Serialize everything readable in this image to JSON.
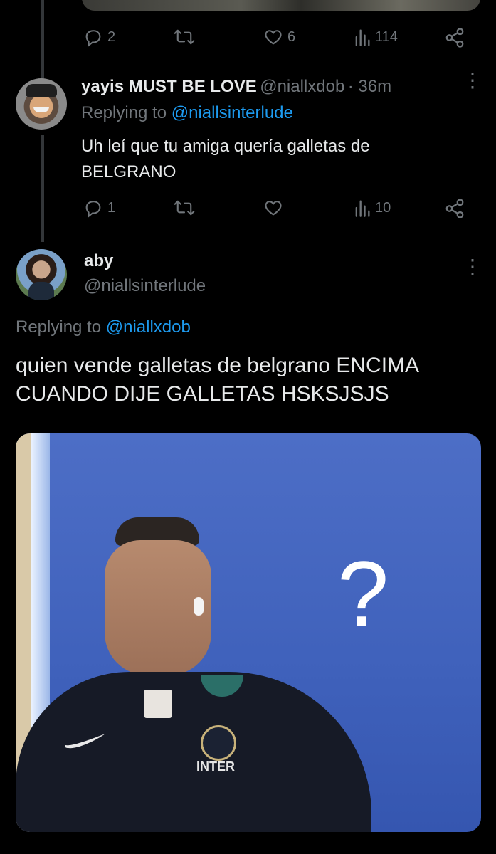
{
  "top_tweet": {
    "actions": {
      "replies": "2",
      "retweets": "",
      "likes": "6",
      "views": "114"
    }
  },
  "reply_tweet": {
    "display_name": "yayis MUST BE LOVE",
    "handle": "@niallxdob",
    "time": "· 36m",
    "replying_to_label": "Replying to",
    "replying_to_handle": "@niallsinterlude",
    "text_line1": "Uh leí que tu amiga quería galletas de",
    "text_line2": "BELGRANO",
    "actions": {
      "replies": "1",
      "retweets": "",
      "likes": "",
      "views": "10"
    }
  },
  "main_tweet": {
    "display_name": "aby",
    "handle": "@niallsinterlude",
    "replying_to_label": "Replying to",
    "replying_to_handle": "@niallxdob",
    "text_line1": "quien vende galletas de belgrano ENCIMA",
    "text_line2": "CUANDO DIJE GALLETAS HSKSJSJS",
    "media": {
      "question_mark": "?",
      "logo_text": "INTER"
    }
  },
  "colors": {
    "background": "#000000",
    "text": "#e7e9ea",
    "secondary": "#71767b",
    "link": "#1d9bf0",
    "media_blue": "#3f61bb"
  }
}
